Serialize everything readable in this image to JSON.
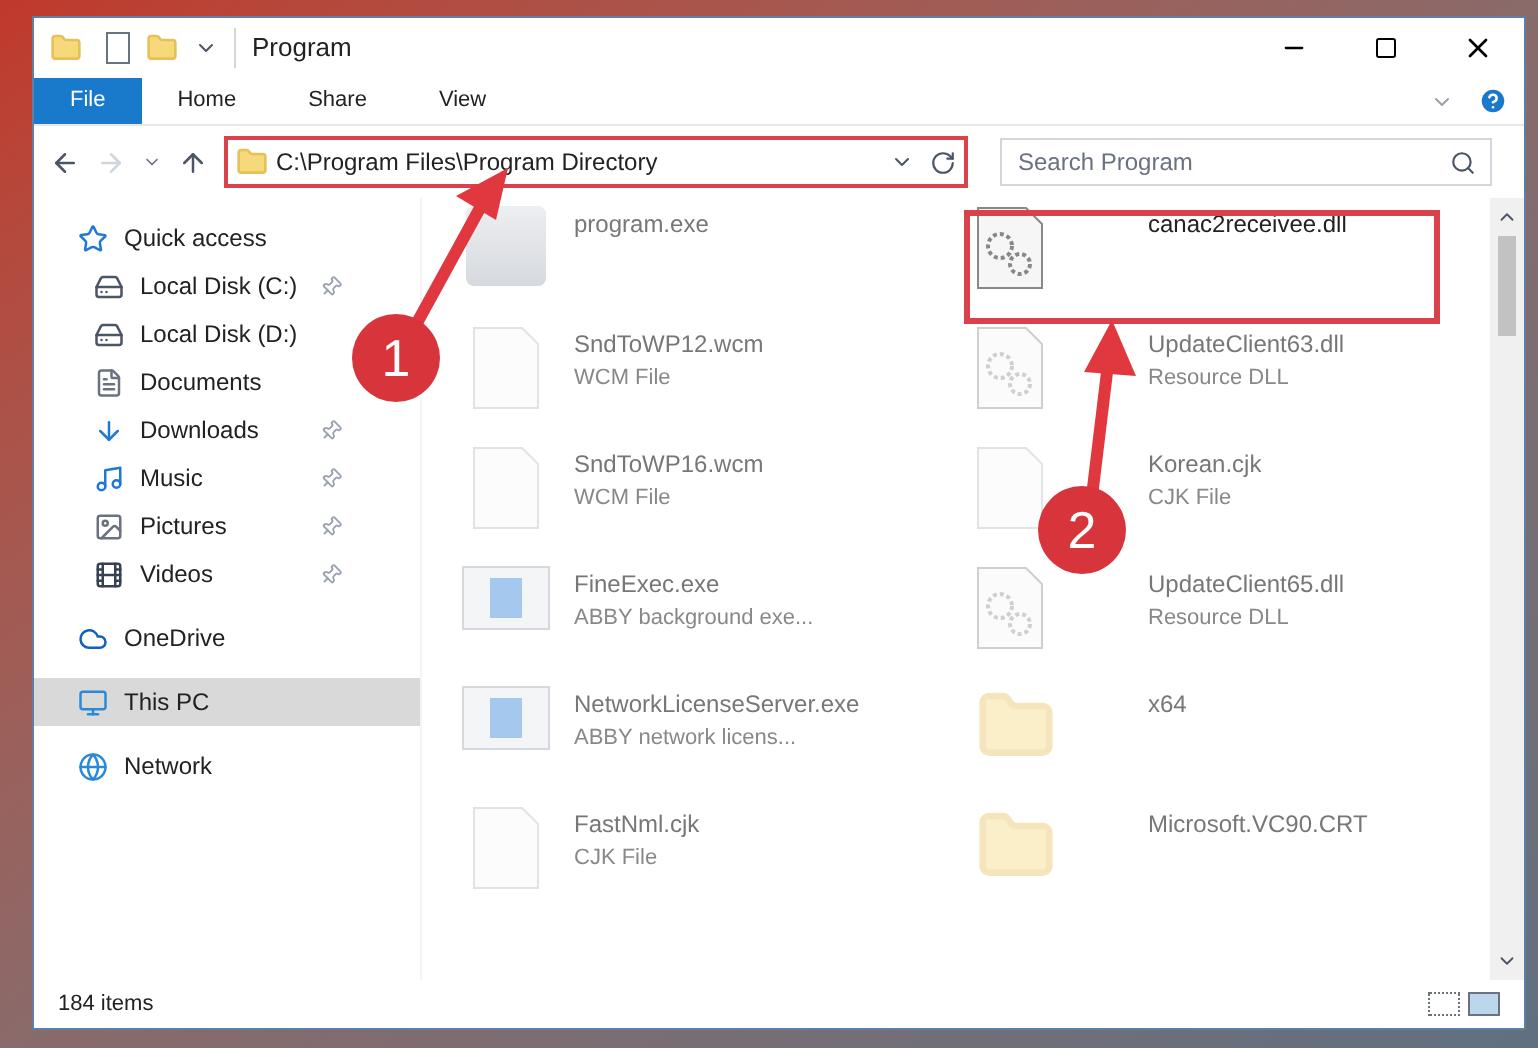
{
  "window": {
    "title": "Program"
  },
  "ribbon_tabs": [
    {
      "label": "File",
      "selected": true
    },
    {
      "label": "Home",
      "selected": false
    },
    {
      "label": "Share",
      "selected": false
    },
    {
      "label": "View",
      "selected": false
    }
  ],
  "address": {
    "path": "C:\\Program Files\\Program Directory"
  },
  "search": {
    "placeholder": "Search Program"
  },
  "sidebar": {
    "items": [
      {
        "label": "Quick access",
        "kind": "quick",
        "pinned": false,
        "selected": false,
        "children": [
          {
            "label": "Local Disk (C:)",
            "kind": "disk",
            "pinned": true,
            "selected": false
          },
          {
            "label": "Local Disk (D:)",
            "kind": "disk",
            "pinned": false,
            "selected": false
          },
          {
            "label": "Documents",
            "kind": "documents",
            "pinned": false,
            "selected": false
          },
          {
            "label": "Downloads",
            "kind": "downloads",
            "pinned": true,
            "selected": false
          },
          {
            "label": "Music",
            "kind": "music",
            "pinned": true,
            "selected": false
          },
          {
            "label": "Pictures",
            "kind": "pictures",
            "pinned": true,
            "selected": false
          },
          {
            "label": "Videos",
            "kind": "videos",
            "pinned": true,
            "selected": false
          }
        ]
      },
      {
        "label": "OneDrive",
        "kind": "cloud",
        "pinned": false,
        "selected": false
      },
      {
        "label": "This PC",
        "kind": "pc",
        "pinned": false,
        "selected": true
      },
      {
        "label": "Network",
        "kind": "network",
        "pinned": false,
        "selected": false
      }
    ]
  },
  "files": [
    {
      "name": "program.exe",
      "kind": "app",
      "faded": true
    },
    {
      "name": "canac2receivee.dll",
      "kind": "dll",
      "faded": false
    },
    {
      "name": "SndToWP12.wcm",
      "type": "WCM File",
      "kind": "doc",
      "faded": true
    },
    {
      "name": "UpdateClient63.dll",
      "type": "Resource DLL",
      "kind": "dll",
      "faded": true
    },
    {
      "name": "SndToWP16.wcm",
      "type": "WCM File",
      "kind": "doc",
      "faded": true
    },
    {
      "name": "Korean.cjk",
      "type": "CJK File",
      "kind": "doc",
      "faded": true
    },
    {
      "name": "FineExec.exe",
      "type": "ABBY background exe...",
      "kind": "window",
      "faded": true
    },
    {
      "name": "UpdateClient65.dll",
      "type": "Resource DLL",
      "kind": "dll",
      "faded": true
    },
    {
      "name": "NetworkLicenseServer.exe",
      "type": "ABBY network licens...",
      "kind": "window",
      "faded": true
    },
    {
      "name": "x64",
      "kind": "folder",
      "faded": true
    },
    {
      "name": "FastNml.cjk",
      "type": "CJK File",
      "kind": "doc",
      "faded": true
    },
    {
      "name": "Microsoft.VC90.CRT",
      "kind": "folder",
      "faded": true
    }
  ],
  "annotations": [
    {
      "label": "1"
    },
    {
      "label": "2"
    }
  ],
  "status_bar": {
    "count": "184 items"
  }
}
